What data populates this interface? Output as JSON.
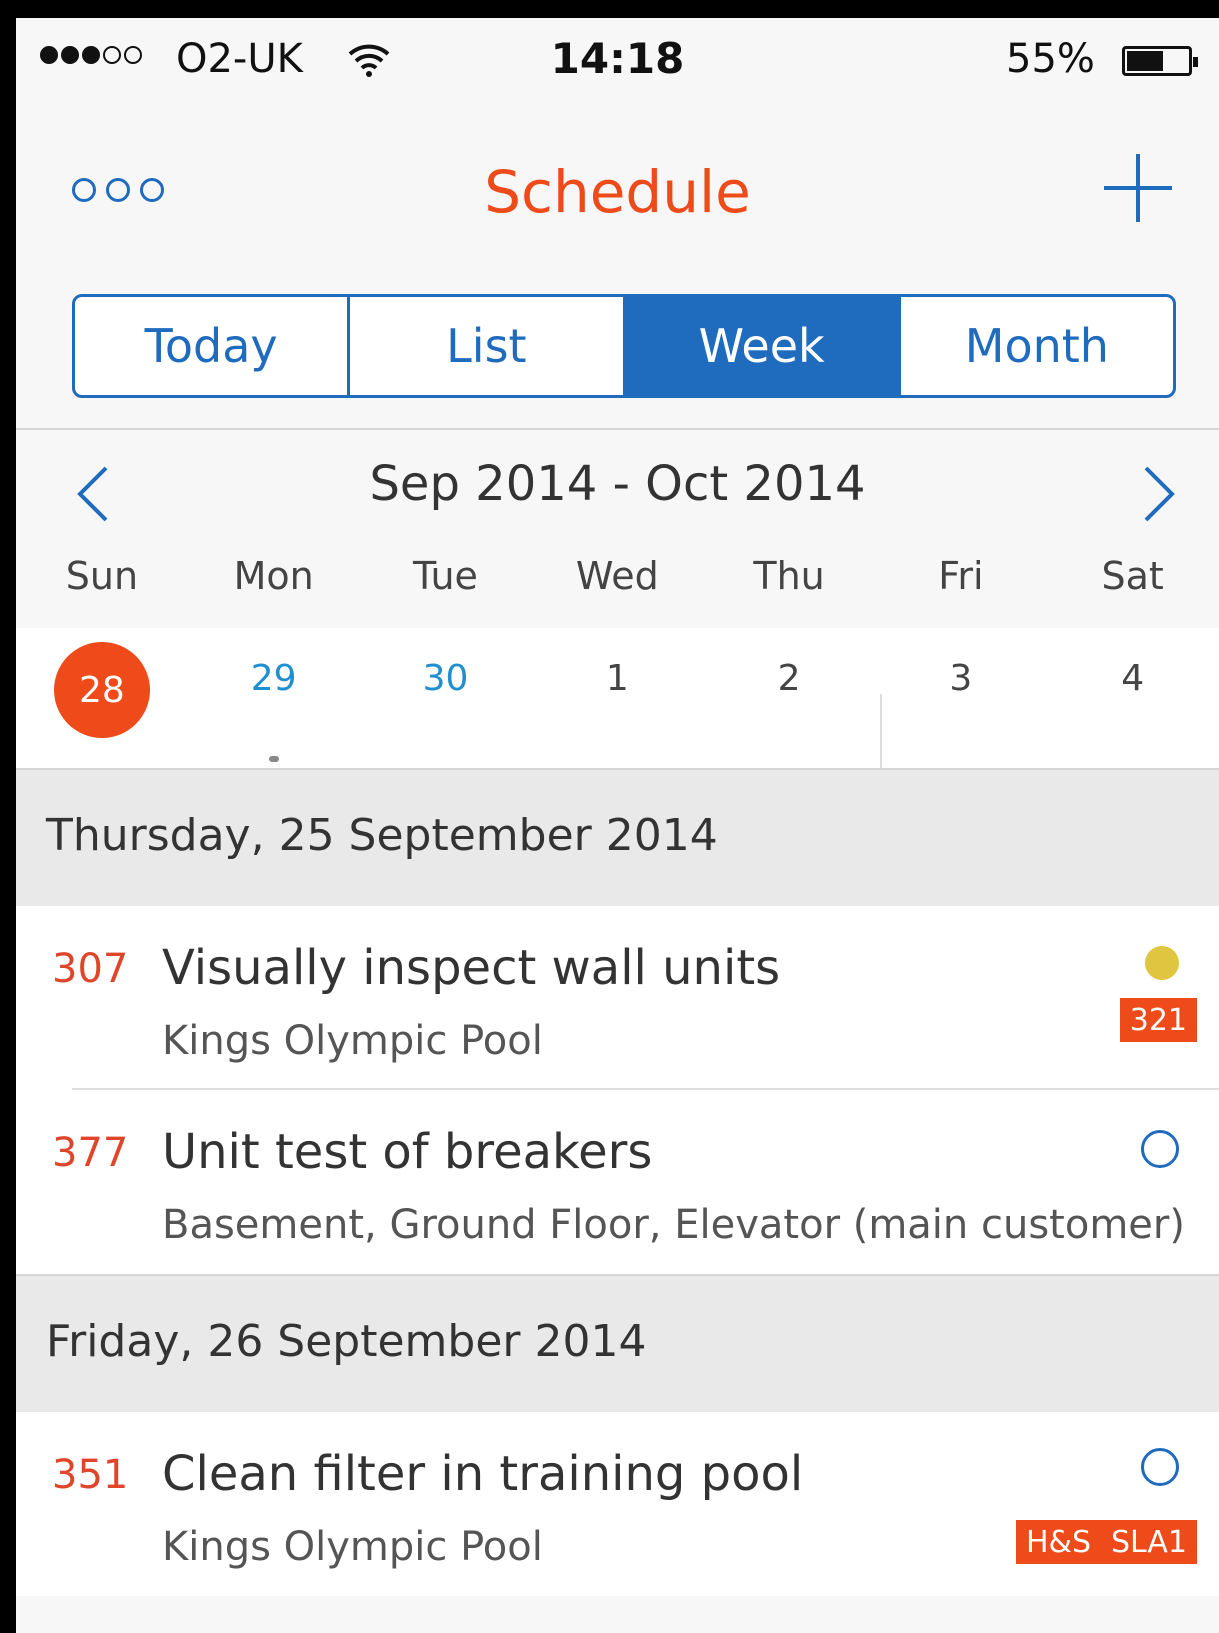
{
  "status": {
    "carrier": "O2-UK",
    "time": "14:18",
    "battery_pct": "55%",
    "signal_bars": 3,
    "signal_total": 5
  },
  "nav": {
    "title": "Schedule",
    "more_icon": "more-dots-icon",
    "add_icon": "plus-icon"
  },
  "tabs": [
    {
      "label": "Today",
      "active": false
    },
    {
      "label": "List",
      "active": false
    },
    {
      "label": "Week",
      "active": true
    },
    {
      "label": "Month",
      "active": false
    }
  ],
  "week": {
    "range": "Sep 2014 - Oct 2014",
    "weekdays": [
      "Sun",
      "Mon",
      "Tue",
      "Wed",
      "Thu",
      "Fri",
      "Sat"
    ],
    "days": [
      {
        "num": "28",
        "state": "today"
      },
      {
        "num": "29",
        "state": "blue"
      },
      {
        "num": "30",
        "state": "blue"
      },
      {
        "num": "1",
        "state": "normal"
      },
      {
        "num": "2",
        "state": "normal"
      },
      {
        "num": "3",
        "state": "normal"
      },
      {
        "num": "4",
        "state": "normal"
      }
    ]
  },
  "sections": [
    {
      "header": "Thursday, 25 September 2014",
      "items": [
        {
          "num": "307",
          "title": "Visually inspect wall units",
          "sub": "Kings Olympic Pool",
          "status": "filled",
          "tags": [
            "321"
          ]
        },
        {
          "num": "377",
          "title": "Unit test of breakers",
          "sub": "Basement, Ground Floor, Elevator (main customer)",
          "status": "hollow",
          "tags": []
        }
      ]
    },
    {
      "header": "Friday, 26 September 2014",
      "items": [
        {
          "num": "351",
          "title": "Clean filter in training pool",
          "sub": "Kings Olympic Pool",
          "status": "hollow",
          "tags": [
            "H&S",
            "SLA1"
          ]
        }
      ]
    }
  ],
  "colors": {
    "accent": "#1f6bbd",
    "brand": "#ee4a1a",
    "status_yellow": "#e0c540"
  }
}
